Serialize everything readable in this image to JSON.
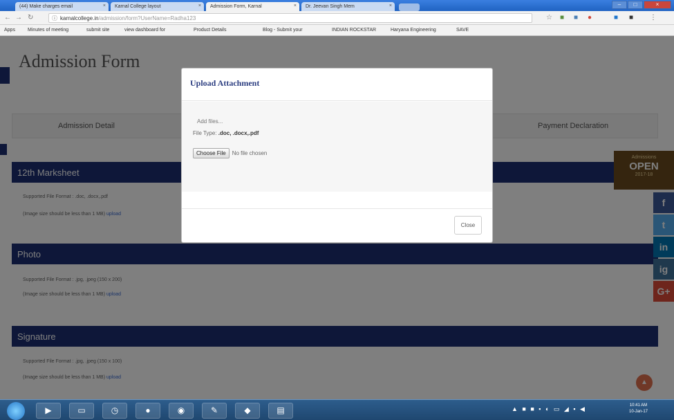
{
  "browser": {
    "tabs": [
      {
        "label": "(44) Make charges email",
        "active": false
      },
      {
        "label": "Karnal College layout",
        "active": false
      },
      {
        "label": "Admission Form, Karnal",
        "active": true
      },
      {
        "label": "Dr. Jeevan Singh Mem",
        "active": false
      }
    ],
    "url_host": "karnalcollege.in",
    "url_path": "/admission/form?UserName=Radha123",
    "bookmarks": [
      "Apps",
      "Minutes of meeting",
      "submit site",
      "view dashboard for",
      "Product Details",
      "Blog - Submit your",
      "INDIAN ROCKSTAR",
      "Haryana Engineering",
      "SAVE"
    ]
  },
  "page": {
    "title": "Admission Form",
    "steps": [
      "Admission Detail",
      "Payment Declaration"
    ],
    "sections": [
      {
        "heading": "12th Marksheet",
        "format_note": "Supported File Format : .doc, .docx,.pdf",
        "size_note": "(Image size should be less than 1 MB)",
        "upload_link": "upload"
      },
      {
        "heading": "Photo",
        "format_note": "Supported File Format : .jpg, .jpeg (150 x 200)",
        "size_note": "(Image size should be less than 1 MB)",
        "upload_link": "upload"
      },
      {
        "heading": "Signature",
        "format_note": "Supported File Format : .jpg, .jpeg (150 x 100)",
        "size_note": "(Image size should be less than 1 MB)",
        "upload_link": "upload"
      }
    ],
    "badge": {
      "line1": "Admissions",
      "line2": "OPEN",
      "line3": "2017-18"
    },
    "social": [
      "f",
      "t",
      "in",
      "ig",
      "G+"
    ]
  },
  "modal": {
    "title": "Upload Attachment",
    "add_files": "Add files...",
    "file_type_label": "File Type:",
    "file_type_value": ".doc, .docx,.pdf",
    "choose_file_label": "Choose File",
    "no_file_text": "No file chosen",
    "close_label": "Close"
  },
  "taskbar": {
    "time": "10:41 AM",
    "date": "10-Jan-17"
  },
  "colors": {
    "navy": "#1c2f73",
    "modal_title": "#2b3d80",
    "taskbar": "#1f4770"
  }
}
